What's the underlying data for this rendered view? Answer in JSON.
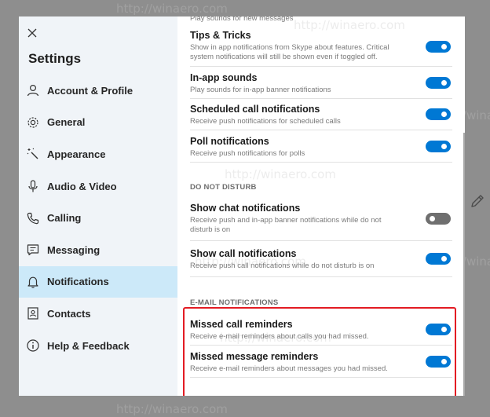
{
  "settings": {
    "title": "Settings"
  },
  "nav": [
    {
      "label": "Account & Profile",
      "icon": "person-icon"
    },
    {
      "label": "General",
      "icon": "gear-icon"
    },
    {
      "label": "Appearance",
      "icon": "magic-wand-icon"
    },
    {
      "label": "Audio & Video",
      "icon": "microphone-icon"
    },
    {
      "label": "Calling",
      "icon": "phone-icon"
    },
    {
      "label": "Messaging",
      "icon": "message-icon"
    },
    {
      "label": "Notifications",
      "icon": "bell-icon",
      "active": true
    },
    {
      "label": "Contacts",
      "icon": "contacts-icon"
    },
    {
      "label": "Help & Feedback",
      "icon": "info-icon"
    }
  ],
  "content": {
    "partial_top_desc": "Play sounds for new messages",
    "items": [
      {
        "title": "Tips & Tricks",
        "desc": "Show in app notifications from Skype about features. Critical system notifications will still be shown even if toggled off.",
        "on": true
      },
      {
        "title": "In-app sounds",
        "desc": "Play sounds for in-app banner notifications",
        "on": true
      },
      {
        "title": "Scheduled call notifications",
        "desc": "Receive push notifications for scheduled calls",
        "on": true
      },
      {
        "title": "Poll notifications",
        "desc": "Receive push notifications for polls",
        "on": true
      }
    ],
    "dnd_header": "DO NOT DISTURB",
    "dnd_items": [
      {
        "title": "Show chat notifications",
        "desc": "Receive push and in-app banner notifications while do not disturb is on",
        "on": false
      },
      {
        "title": "Show call notifications",
        "desc": "Receive push call notifications while do not disturb is on",
        "on": true
      }
    ],
    "email_header": "E-MAIL NOTIFICATIONS",
    "email_items": [
      {
        "title": "Missed call reminders",
        "desc": "Receive e-mail reminders about calls you had missed.",
        "on": true
      },
      {
        "title": "Missed message reminders",
        "desc": "Receive e-mail reminders about messages you had missed.",
        "on": true
      }
    ]
  },
  "watermark": "http://winaero.com",
  "colors": {
    "accent": "#0078d4",
    "active_nav": "#cce9f9",
    "highlight": "#e31b23",
    "toggle_off": "#6f6f6f"
  }
}
